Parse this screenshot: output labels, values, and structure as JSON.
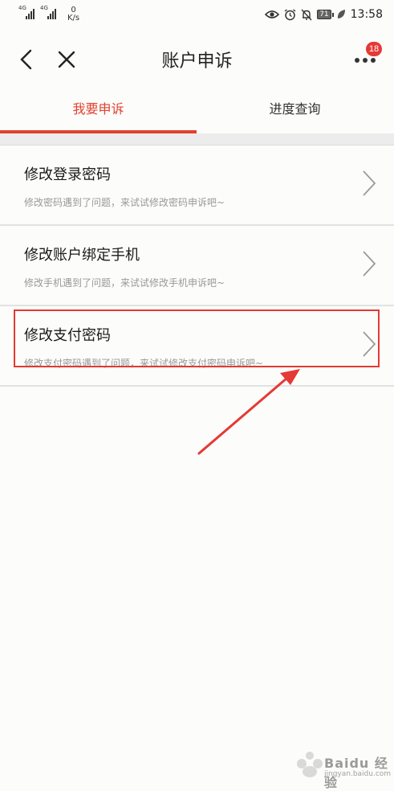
{
  "status_bar": {
    "network_1": "4G",
    "network_2": "4G",
    "speed_value": "0",
    "speed_unit": "K/s",
    "battery": "71",
    "time": "13:58",
    "icons": [
      "eye-icon",
      "alarm-icon",
      "mute-icon",
      "battery-icon",
      "leaf-icon"
    ]
  },
  "header": {
    "title": "账户申诉",
    "badge_count": "18",
    "icons": [
      "back-icon",
      "close-icon",
      "more-icon"
    ]
  },
  "tabs": [
    {
      "label": "我要申诉",
      "active": true
    },
    {
      "label": "进度查询",
      "active": false
    }
  ],
  "items": [
    {
      "title": "修改登录密码",
      "subtitle": "修改密码遇到了问题，来试试修改密码申诉吧~"
    },
    {
      "title": "修改账户绑定手机",
      "subtitle": "修改手机遇到了问题，来试试修改手机申诉吧~"
    },
    {
      "title": "修改支付密码",
      "subtitle": "修改支付密码遇到了问题，来试试修改支付密码申诉吧~"
    }
  ],
  "colors": {
    "accent": "#e2402f",
    "annotation_red": "#e53935",
    "background": "#fcfcfa"
  },
  "watermark": {
    "brand": "Baidu 经验",
    "url": "jingyan.baidu.com"
  }
}
